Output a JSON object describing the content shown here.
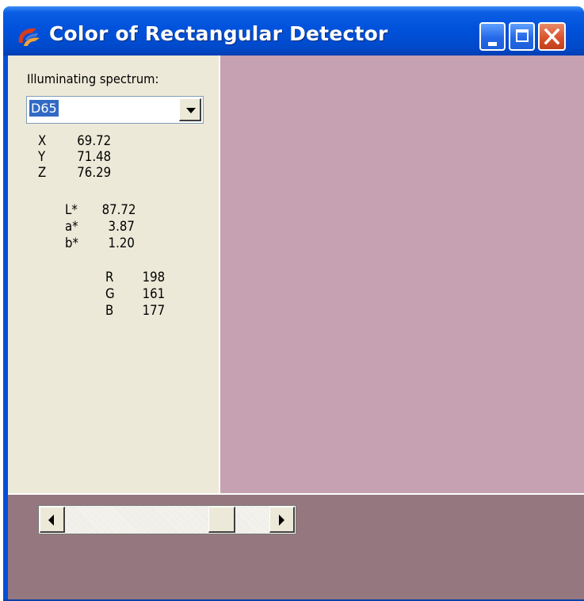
{
  "window": {
    "title": "Color of Rectangular Detector",
    "icon": "app-icon",
    "controls": [
      "minimize-icon",
      "maximize-icon",
      "close-icon"
    ]
  },
  "colors": {
    "swatch": "#c5a1b1",
    "bottom_panel": "#95787f",
    "panel_bg": "#ece9d8",
    "title_blue": "#0052dc"
  },
  "spectrum": {
    "label": "Illuminating spectrum:",
    "selected": "D65"
  },
  "xyz": [
    {
      "key": "X",
      "value": "69.72"
    },
    {
      "key": "Y",
      "value": "71.48"
    },
    {
      "key": "Z",
      "value": "76.29"
    }
  ],
  "lab": [
    {
      "key": "L*",
      "value": "87.72"
    },
    {
      "key": "a*",
      "value": "3.87"
    },
    {
      "key": "b*",
      "value": "1.20"
    }
  ],
  "rgb": [
    {
      "key": "R",
      "value": "198"
    },
    {
      "key": "G",
      "value": "161"
    },
    {
      "key": "B",
      "value": "177"
    }
  ],
  "slider": {
    "position_fraction": 0.81
  }
}
